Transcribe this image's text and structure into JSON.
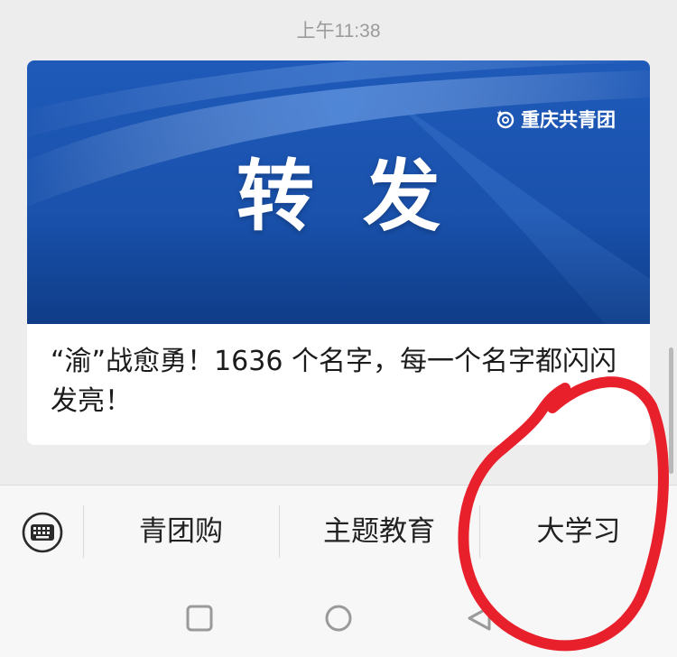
{
  "timestamp": "上午11:38",
  "card": {
    "banner_title": "转发",
    "brand_name": "重庆共青团",
    "brand_icon": "at-star-logo",
    "title": "“渝”战愈勇！1636 个名字，每一个名字都闪闪发亮！"
  },
  "menu": {
    "keyboard_icon": "keyboard-icon",
    "items": [
      {
        "label": "青团购"
      },
      {
        "label": "主题教育"
      },
      {
        "label": "大学习"
      }
    ]
  },
  "nav": {
    "recents_icon": "square-icon",
    "home_icon": "circle-icon",
    "back_icon": "triangle-back-icon"
  },
  "colors": {
    "banner_blue": "#1a52ad",
    "annotation_red": "#e8202c",
    "background": "#ededed"
  }
}
